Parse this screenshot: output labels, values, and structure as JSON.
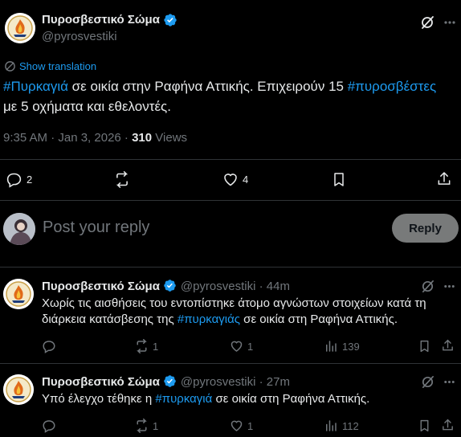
{
  "main_tweet": {
    "author_name": "Πυροσβεστικό Σώμα",
    "author_handle": "@pyrosvestiki",
    "show_translation": "Show translation",
    "text_parts": {
      "hashtag1": "#Πυρκαγιά",
      "text1": " σε οικία στην Ραφήνα Αττικής. Επιχειρούν 15 ",
      "hashtag2": "#πυροσβέστες",
      "text2": "με 5 οχήματα και εθελοντές."
    },
    "timestamp": "9:35 AM · Jan 3, 2026 · ",
    "views_count": "310",
    "views_label": " Views",
    "replies": "2",
    "likes": "4"
  },
  "reply_composer": {
    "placeholder": "Post your reply",
    "button_label": "Reply"
  },
  "replies": [
    {
      "author_name": "Πυροσβεστικό Σώμα",
      "author_handle": "@pyrosvestiki",
      "time": " · 44m",
      "text_line1": "Χωρίς τις αισθήσεις του εντοπίστηκε άτομο αγνώστων στοιχείων κατά τη",
      "text_line2_a": "διάρκεια κατάσβεσης της ",
      "text_line2_hashtag": "#πυρκαγιάς",
      "text_line2_b": " σε οικία στη Ραφήνα Αττικής.",
      "reposts": "1",
      "likes": "1",
      "views": "139"
    },
    {
      "author_name": "Πυροσβεστικό Σώμα",
      "author_handle": "@pyrosvestiki",
      "time": " · 27m",
      "text_a": "Υπό έλεγχο τέθηκε η ",
      "text_hashtag": "#πυρκαγιά",
      "text_b": " σε οικία στη Ραφήνα Αττικής.",
      "reposts": "1",
      "likes": "1",
      "views": "112"
    }
  ],
  "colors": {
    "background": "#000000",
    "text": "#e7e9ea",
    "muted": "#71767b",
    "link": "#1d9bf0",
    "verified": "#1d9bf0",
    "divider": "#2f3336"
  },
  "icons": [
    "verified-badge-icon",
    "grok-icon",
    "more-icon",
    "translate-icon",
    "reply-icon",
    "repost-icon",
    "like-icon",
    "bookmark-icon",
    "share-icon",
    "views-icon"
  ]
}
